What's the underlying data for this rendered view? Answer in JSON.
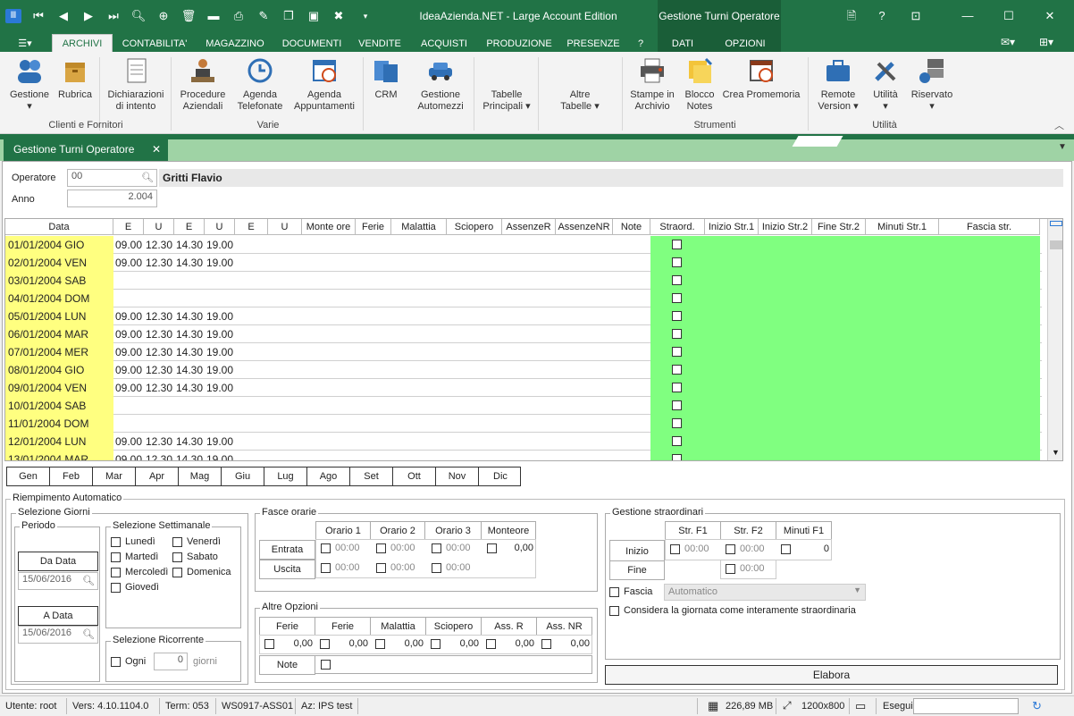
{
  "window": {
    "title": "IdeaAzienda.NET - Large Account Edition",
    "context_title": "Gestione Turni Operatore"
  },
  "ribbon_tabs": [
    "ARCHIVI",
    "CONTABILITA'",
    "MAGAZZINO",
    "DOCUMENTI",
    "VENDITE",
    "ACQUISTI",
    "PRODUZIONE",
    "PRESENZE",
    "?",
    "DATI",
    "OPZIONI"
  ],
  "ribbon": {
    "buttons": [
      {
        "l1": "Gestione",
        "l2": "▾"
      },
      {
        "l1": "Rubrica",
        "l2": ""
      },
      {
        "l1": "Dichiarazioni",
        "l2": "di intento"
      },
      {
        "l1": "Procedure",
        "l2": "Aziendali"
      },
      {
        "l1": "Agenda",
        "l2": "Telefonate"
      },
      {
        "l1": "Agenda",
        "l2": "Appuntamenti"
      },
      {
        "l1": "CRM",
        "l2": ""
      },
      {
        "l1": "Gestione",
        "l2": "Automezzi"
      },
      {
        "l1": "Tabelle",
        "l2": "Principali ▾"
      },
      {
        "l1": "Altre",
        "l2": "Tabelle ▾"
      },
      {
        "l1": "Stampe in",
        "l2": "Archivio"
      },
      {
        "l1": "Blocco",
        "l2": "Notes"
      },
      {
        "l1": "Crea Promemoria",
        "l2": ""
      },
      {
        "l1": "Remote",
        "l2": "Version ▾"
      },
      {
        "l1": "Utilità",
        "l2": "▾"
      },
      {
        "l1": "Riservato",
        "l2": "▾"
      }
    ],
    "groups": [
      "Clienti e Fornitori",
      "Varie",
      "Strumenti",
      "Utilità"
    ]
  },
  "doc_tab": "Gestione Turni Operatore",
  "form": {
    "operatore_label": "Operatore",
    "operatore_code": "00",
    "operatore_name": "Gritti Flavio",
    "anno_label": "Anno",
    "anno_value": "2.004"
  },
  "grid": {
    "headers": [
      "Data",
      "E",
      "U",
      "E",
      "U",
      "E",
      "U",
      "Monte ore",
      "Ferie",
      "Malattia",
      "Sciopero",
      "AssenzeR",
      "AssenzeNR",
      "Note",
      "Straord.",
      "Inizio Str.1",
      "Inizio Str.2",
      "Fine Str.2",
      "Minuti Str.1",
      "Fascia str."
    ],
    "rows": [
      {
        "data": "01/01/2004 GIO",
        "e1": "09.00",
        "u1": "12.30",
        "e2": "14.30",
        "u2": "19.00"
      },
      {
        "data": "02/01/2004 VEN",
        "e1": "09.00",
        "u1": "12.30",
        "e2": "14.30",
        "u2": "19.00"
      },
      {
        "data": "03/01/2004 SAB",
        "e1": "",
        "u1": "",
        "e2": "",
        "u2": ""
      },
      {
        "data": "04/01/2004 DOM",
        "e1": "",
        "u1": "",
        "e2": "",
        "u2": ""
      },
      {
        "data": "05/01/2004 LUN",
        "e1": "09.00",
        "u1": "12.30",
        "e2": "14.30",
        "u2": "19.00"
      },
      {
        "data": "06/01/2004 MAR",
        "e1": "09.00",
        "u1": "12.30",
        "e2": "14.30",
        "u2": "19.00"
      },
      {
        "data": "07/01/2004 MER",
        "e1": "09.00",
        "u1": "12.30",
        "e2": "14.30",
        "u2": "19.00"
      },
      {
        "data": "08/01/2004 GIO",
        "e1": "09.00",
        "u1": "12.30",
        "e2": "14.30",
        "u2": "19.00"
      },
      {
        "data": "09/01/2004 VEN",
        "e1": "09.00",
        "u1": "12.30",
        "e2": "14.30",
        "u2": "19.00"
      },
      {
        "data": "10/01/2004 SAB",
        "e1": "",
        "u1": "",
        "e2": "",
        "u2": ""
      },
      {
        "data": "11/01/2004 DOM",
        "e1": "",
        "u1": "",
        "e2": "",
        "u2": ""
      },
      {
        "data": "12/01/2004 LUN",
        "e1": "09.00",
        "u1": "12.30",
        "e2": "14.30",
        "u2": "19.00"
      },
      {
        "data": "13/01/2004 MAR",
        "e1": "09.00",
        "u1": "12.30",
        "e2": "14.30",
        "u2": "19.00"
      }
    ]
  },
  "months": [
    "Gen",
    "Feb",
    "Mar",
    "Apr",
    "Mag",
    "Giu",
    "Lug",
    "Ago",
    "Set",
    "Ott",
    "Nov",
    "Dic"
  ],
  "auto": {
    "title": "Riempimento Automatico",
    "sel_giorni": "Selezione Giorni",
    "periodo": "Periodo",
    "da_data_btn": "Da Data",
    "da_data": "15/06/2016",
    "a_data_btn": "A Data",
    "a_data": "15/06/2016",
    "sel_sett": "Selezione Settimanale",
    "days": [
      "Lunedì",
      "Martedì",
      "Mercoledì",
      "Giovedì",
      "Venerdì",
      "Sabato",
      "Domenica"
    ],
    "sel_ric": "Selezione Ricorrente",
    "ogni": "Ogni",
    "ogni_val": "0",
    "giorni": "giorni",
    "fasce_title": "Fasce orarie",
    "fasce_cols": [
      "Orario 1",
      "Orario 2",
      "Orario 3",
      "Monteore"
    ],
    "entrata": "Entrata",
    "uscita": "Uscita",
    "time_val": "00:00",
    "monte_val": "0,00",
    "altre_title": "Altre Opzioni",
    "altre_cols": [
      "Ferie",
      "Ferie",
      "Malattia",
      "Sciopero",
      "Ass. R",
      "Ass. NR"
    ],
    "zero": "0,00",
    "note": "Note",
    "straord_title": "Gestione straordinari",
    "straord_cols": [
      "Str. F1",
      "Str. F2",
      "Minuti F1"
    ],
    "inizio": "Inizio",
    "fine": "Fine",
    "min_val": "0",
    "fascia": "Fascia",
    "fascia_val": "Automatico",
    "considera": "Considera la giornata come interamente straordinaria",
    "elabora": "Elabora"
  },
  "status": {
    "utente": "Utente: root",
    "vers": "Vers: 4.10.1104.0",
    "term": "Term: 053",
    "ws": "WS0917-ASS01",
    "az": "Az: IPS test",
    "mem": "226,89 MB",
    "res": "1200x800",
    "esegui": "Esegui"
  },
  "colors": {
    "green": "#217346",
    "grid_green": "#80ff80",
    "date_yellow": "#ffff80"
  }
}
